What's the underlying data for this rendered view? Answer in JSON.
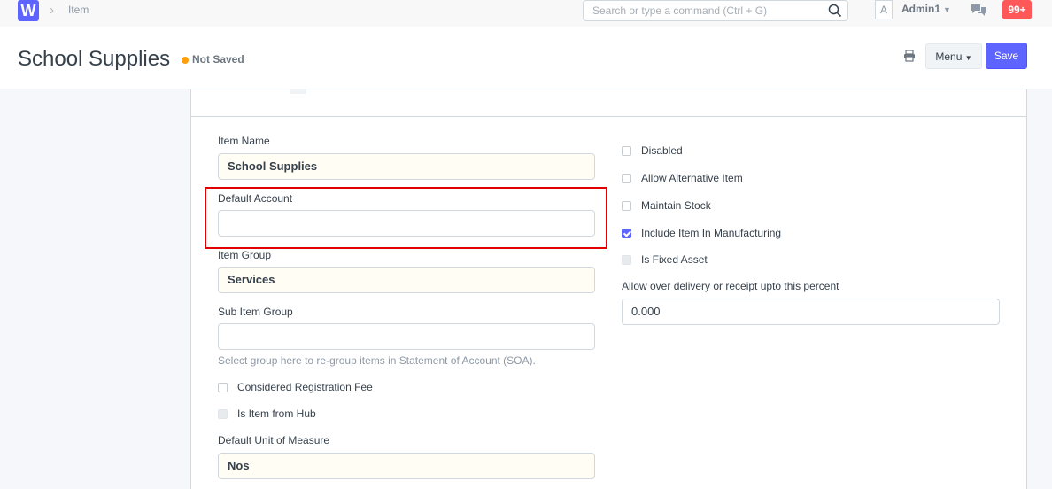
{
  "navbar": {
    "logo_letter": "W",
    "breadcrumb": "Item",
    "search_placeholder": "Search or type a command (Ctrl + G)",
    "avatar_letter": "A",
    "user_name": "Admin1",
    "notification_count": "99+"
  },
  "page": {
    "title": "School Supplies",
    "status": "Not Saved",
    "menu_label": "Menu",
    "save_label": "Save"
  },
  "form": {
    "item_name": {
      "label": "Item Name",
      "value": "School Supplies"
    },
    "default_account": {
      "label": "Default Account",
      "value": ""
    },
    "item_group": {
      "label": "Item Group",
      "value": "Services"
    },
    "sub_item_group": {
      "label": "Sub Item Group",
      "value": "",
      "help": "Select group here to re-group items in Statement of Account (SOA)."
    },
    "considered_registration_fee": {
      "label": "Considered Registration Fee",
      "checked": false
    },
    "is_item_from_hub": {
      "label": "Is Item from Hub",
      "checked": false
    },
    "default_uom": {
      "label": "Default Unit of Measure",
      "value": "Nos"
    },
    "disabled": {
      "label": "Disabled",
      "checked": false
    },
    "allow_alternative_item": {
      "label": "Allow Alternative Item",
      "checked": false
    },
    "maintain_stock": {
      "label": "Maintain Stock",
      "checked": false
    },
    "include_item_in_manufacturing": {
      "label": "Include Item In Manufacturing",
      "checked": true
    },
    "is_fixed_asset": {
      "label": "Is Fixed Asset",
      "checked": false
    },
    "over_delivery": {
      "label": "Allow over delivery or receipt upto this percent",
      "value": "0.000"
    }
  },
  "colors": {
    "primary": "#5e64ff",
    "unsaved": "#ffa00a",
    "notification": "#ff5858",
    "highlight": "#e00000"
  },
  "icons": [
    "search-icon",
    "print-icon",
    "chat-icon",
    "chevron-right-icon",
    "caret-down-icon"
  ]
}
